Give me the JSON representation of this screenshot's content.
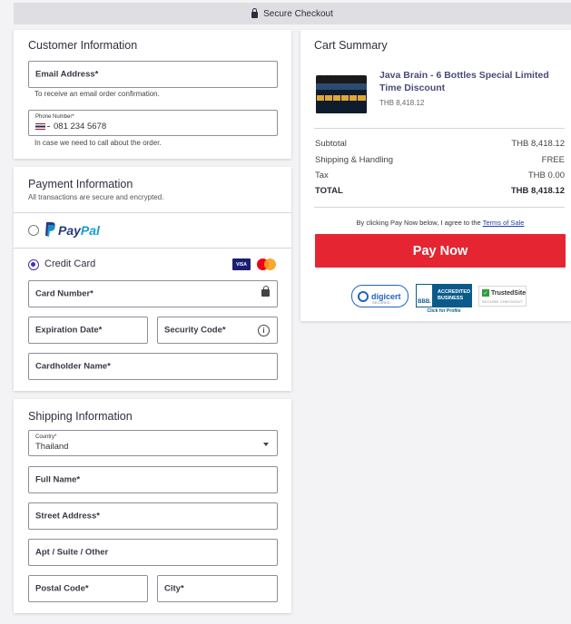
{
  "header": {
    "secure_checkout": "Secure Checkout"
  },
  "customer": {
    "title": "Customer Information",
    "email_label": "Email Address*",
    "email_hint": "To receive an email order confirmation.",
    "phone_label": "Phone Number*",
    "phone_value": "081 234 5678",
    "phone_hint": "In case we need to call about the order."
  },
  "payment": {
    "title": "Payment Information",
    "subtitle": "All transactions are secure and encrypted.",
    "paypal_pay": "Pay",
    "paypal_pal": "Pal",
    "credit_card_label": "Credit Card",
    "visa_label": "VISA",
    "card_number_label": "Card Number*",
    "expiration_label": "Expiration Date*",
    "security_label": "Security Code*",
    "cardholder_label": "Cardholder Name*"
  },
  "shipping": {
    "title": "Shipping Information",
    "country_label": "Country*",
    "country_value": "Thailand",
    "full_name_label": "Full Name*",
    "street_label": "Street Address*",
    "apt_label": "Apt / Suite / Other",
    "postal_label": "Postal Code*",
    "city_label": "City*"
  },
  "cart": {
    "title": "Cart Summary",
    "product_name": "Java Brain - 6 Bottles Special Limited Time Discount",
    "product_price": "THB 8,418.12",
    "rows": [
      {
        "label": "Subtotal",
        "value": "THB 8,418.12"
      },
      {
        "label": "Shipping & Handling",
        "value": "FREE"
      },
      {
        "label": "Tax",
        "value": "THB 0.00"
      }
    ],
    "total_label": "TOTAL",
    "total_value": "THB 8,418.12",
    "terms_text": "By clicking Pay Now below, I agree to the",
    "terms_link": "Terms of Sale",
    "pay_now": "Pay Now",
    "digicert": "digicert",
    "digicert_sub": "SECURED",
    "bbb_logo": "BBB.",
    "bbb_line1": "ACCREDITED",
    "bbb_line2": "BUSINESS",
    "bbb_sub": "Click for Profile",
    "trusted": "TrustedSite",
    "trusted_sub": "SECURE CHECKOUT"
  },
  "colors": {
    "accent": "#4a2fb0",
    "pay_button": "#e52531",
    "paypal_dark": "#253b80",
    "paypal_light": "#179bd7"
  },
  "icons": [
    "lock-icon",
    "padlock-icon",
    "info-icon",
    "thai-flag-icon",
    "chevron-down-icon",
    "visa-icon",
    "mastercard-icon",
    "paypal-logo"
  ]
}
